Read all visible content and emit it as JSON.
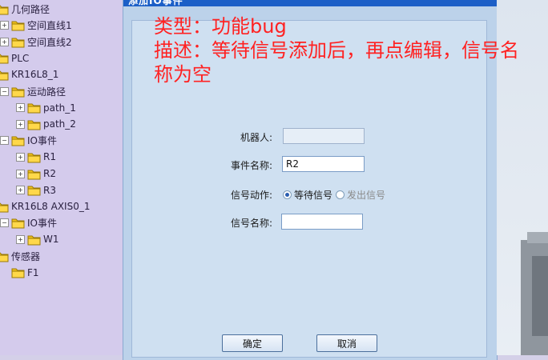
{
  "tree": {
    "items": [
      {
        "label": "几何路径",
        "level": 0,
        "expander": ""
      },
      {
        "label": "空间直线1",
        "level": 1,
        "expander": "+"
      },
      {
        "label": "空间直线2",
        "level": 1,
        "expander": "+"
      },
      {
        "label": "PLC",
        "level": 0,
        "expander": ""
      },
      {
        "label": "KR16L8_1",
        "level": 0,
        "expander": ""
      },
      {
        "label": "运动路径",
        "level": 1,
        "expander": "-"
      },
      {
        "label": "path_1",
        "level": 2,
        "expander": "+"
      },
      {
        "label": "path_2",
        "level": 2,
        "expander": "+"
      },
      {
        "label": "IO事件",
        "level": 1,
        "expander": "-"
      },
      {
        "label": "R1",
        "level": 2,
        "expander": "+"
      },
      {
        "label": "R2",
        "level": 2,
        "expander": "+"
      },
      {
        "label": "R3",
        "level": 2,
        "expander": "+"
      },
      {
        "label": "KR16L8 AXIS0_1",
        "level": 0,
        "expander": ""
      },
      {
        "label": "IO事件",
        "level": 1,
        "expander": "-"
      },
      {
        "label": "W1",
        "level": 2,
        "expander": "+"
      },
      {
        "label": "传感器",
        "level": 0,
        "expander": ""
      },
      {
        "label": "F1",
        "level": 1,
        "expander": ""
      }
    ]
  },
  "dialog": {
    "title": "添加IO事件",
    "annotation": {
      "line1": "类型：功能bug",
      "line2": "描述：等待信号添加后，再点编辑，信号名",
      "line3": "称为空"
    },
    "fields": {
      "robot_label": "机器人:",
      "robot_value": "",
      "event_name_label": "事件名称:",
      "event_name_value": "R2",
      "signal_action_label": "信号动作:",
      "radio_wait": "等待信号",
      "radio_send": "发出信号",
      "selected_action": "等待信号",
      "signal_name_label": "信号名称:",
      "signal_name_value": ""
    },
    "buttons": {
      "ok": "确定",
      "cancel": "取消"
    }
  },
  "colors": {
    "titlebar": "#1c5fc7",
    "annotation": "#ff2222",
    "tree_bg": "#d4cbec",
    "folder": "#f2c21b"
  }
}
